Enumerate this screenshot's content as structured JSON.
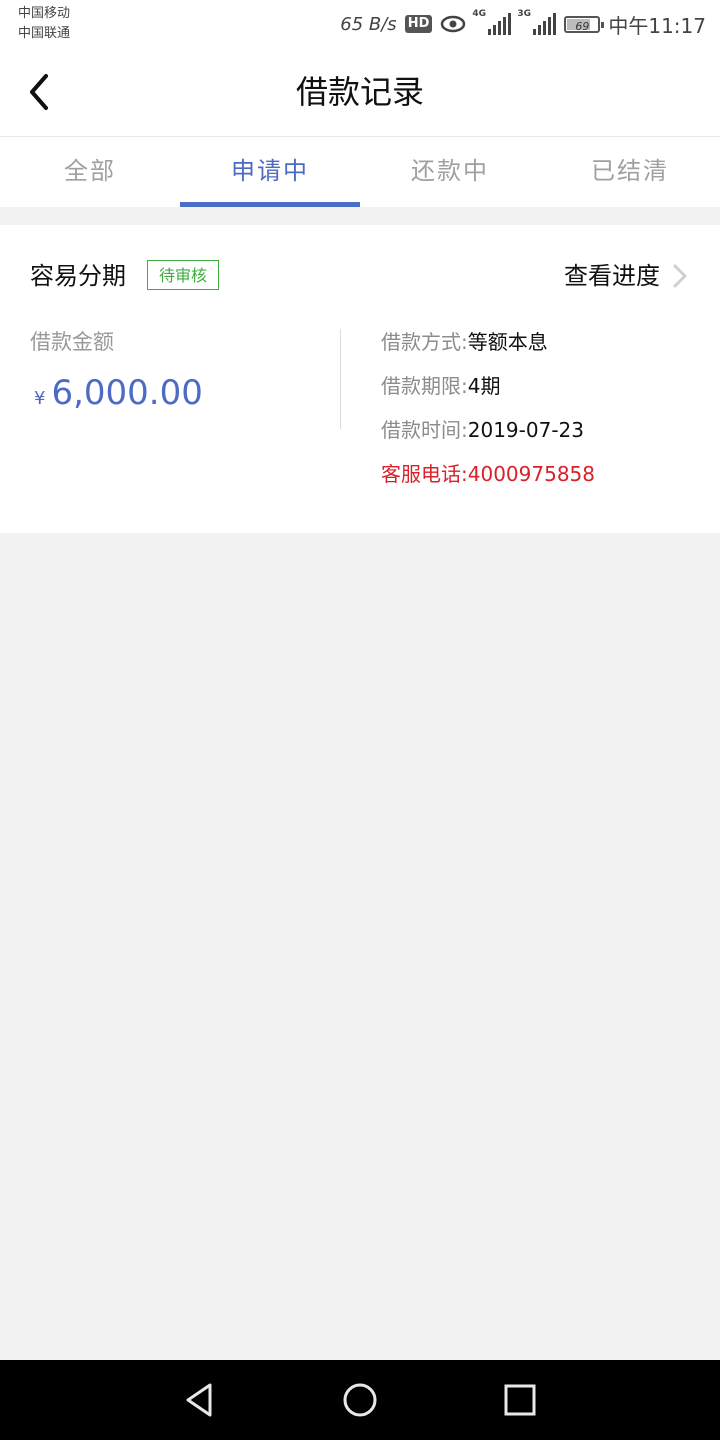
{
  "status_bar": {
    "carrier_1": "中国移动",
    "carrier_2": "中国联通",
    "net_speed": "65 B/s",
    "hd_badge": "HD",
    "signal_1_label": "4G",
    "signal_2_label": "3G",
    "battery": "69",
    "time": "中午11:17"
  },
  "header": {
    "title": "借款记录",
    "back_icon": "chevron-left-icon"
  },
  "tabs": [
    {
      "label": "全部",
      "active": false
    },
    {
      "label": "申请中",
      "active": true
    },
    {
      "label": "还款中",
      "active": false
    },
    {
      "label": "已结清",
      "active": false
    }
  ],
  "loan_card": {
    "product_name": "容易分期",
    "status_badge": "待审核",
    "progress_link": "查看进度",
    "amount_label": "借款金额",
    "currency_symbol": "¥",
    "amount": "6,000.00",
    "details": [
      {
        "key": "借款方式:",
        "value": "等额本息"
      },
      {
        "key": "借款期限:",
        "value": "4期"
      },
      {
        "key": "借款时间:",
        "value": "2019-07-23"
      }
    ],
    "hotline": {
      "key": "客服电话:",
      "value": "4000975858"
    }
  },
  "nav_bar": {
    "back_icon": "triangle-back-icon",
    "home_icon": "circle-home-icon",
    "recents_icon": "square-recents-icon"
  },
  "colors": {
    "accent_blue": "#4b6bc4",
    "badge_green": "#3fae3f",
    "hotline_red": "#d9212b"
  }
}
